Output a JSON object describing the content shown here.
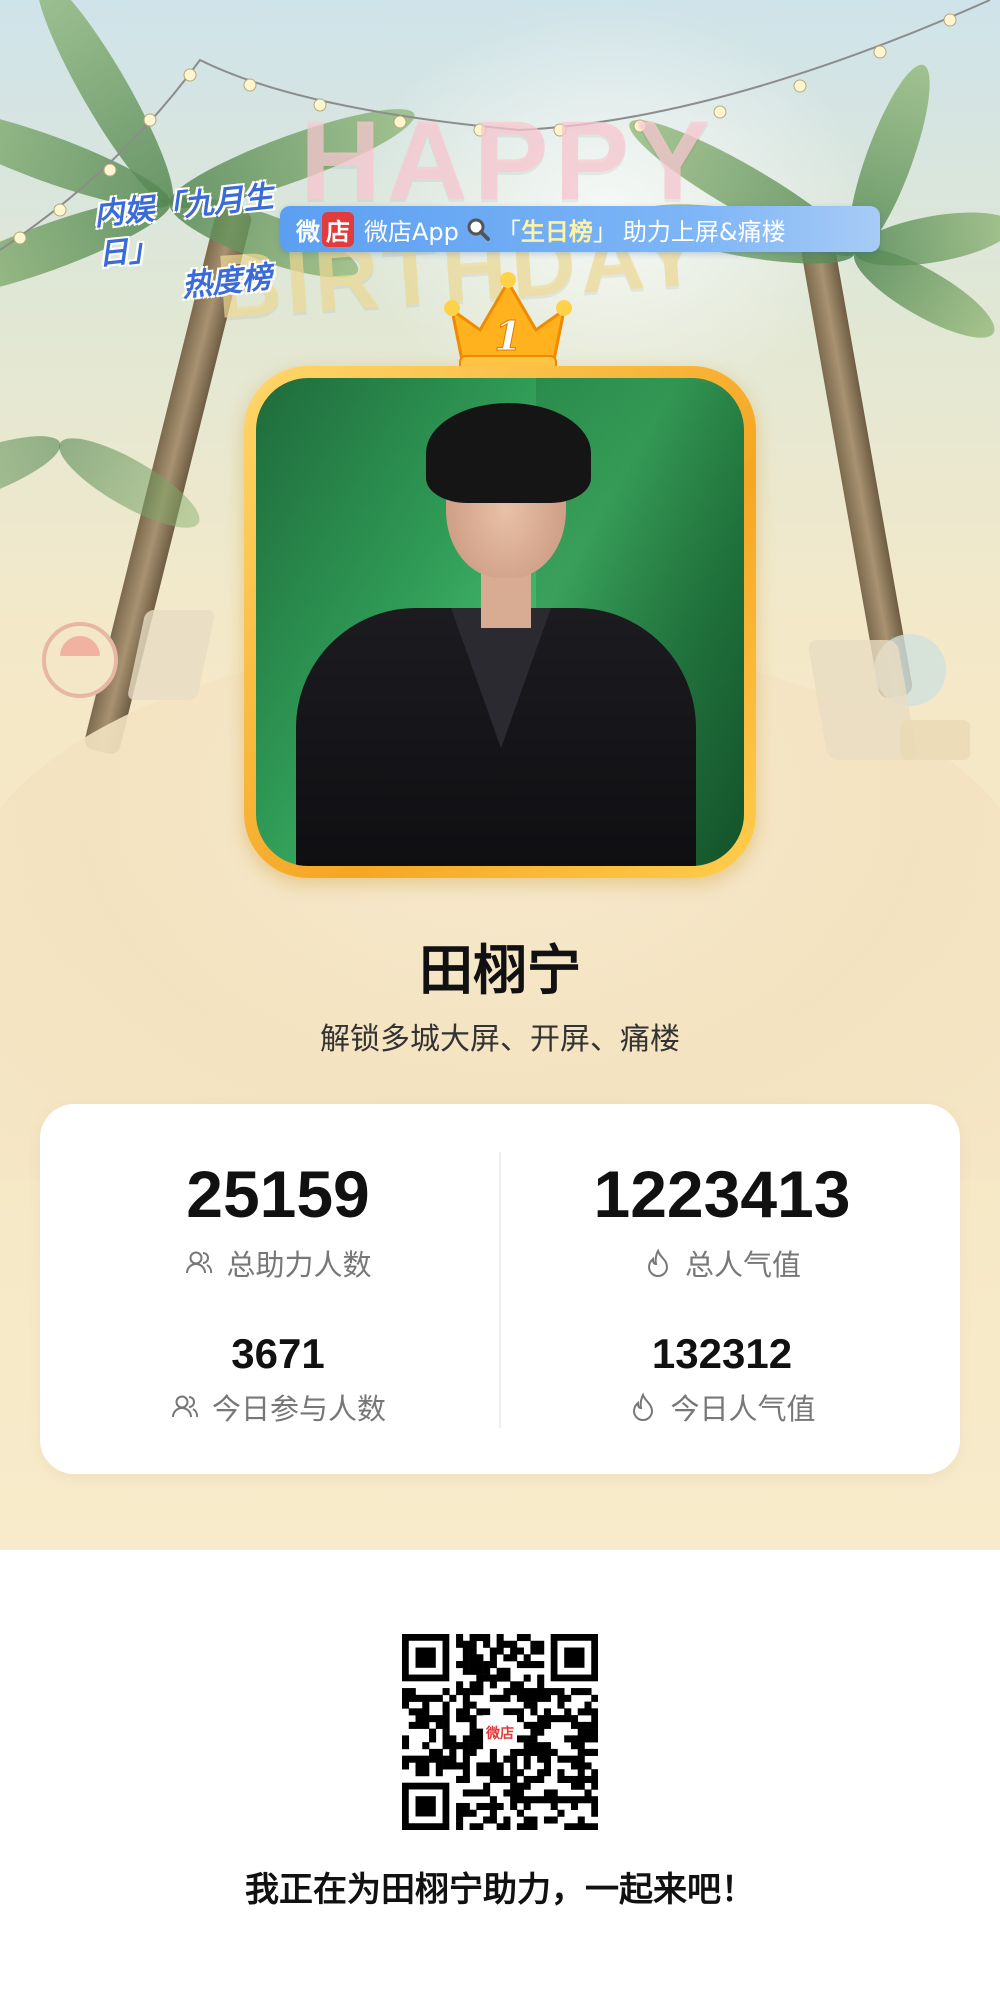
{
  "banner": {
    "logo_line1": "内娱「九月生日」",
    "logo_line2": "热度榜",
    "wd_text": "微",
    "wd_box": "店",
    "app_text": "微店App",
    "search_prefix": "「",
    "search_keyword": "生日榜",
    "search_suffix": "」",
    "tail_text": "助力上屏&痛楼"
  },
  "decor": {
    "happy": "HAPPY",
    "birthday": "BIRTHDAY",
    "rank": "1"
  },
  "profile": {
    "name": "田栩宁",
    "subtitle": "解锁多城大屏、开屏、痛楼"
  },
  "stats": {
    "total_supporters": {
      "value": "25159",
      "label": "总助力人数",
      "icon": "users-icon"
    },
    "total_popularity": {
      "value": "1223413",
      "label": "总人气值",
      "icon": "flame-icon"
    },
    "today_participants": {
      "value": "3671",
      "label": "今日参与人数",
      "icon": "users-icon"
    },
    "today_popularity": {
      "value": "132312",
      "label": "今日人气值",
      "icon": "flame-icon"
    }
  },
  "footer": {
    "qr_logo": "微店",
    "cta": "我正在为田栩宁助力，一起来吧！"
  },
  "colors": {
    "banner_blue": "#5c9ff2",
    "keyword_yellow": "#fff2a6",
    "frame_gold": "#f5a623",
    "weidian_red": "#e23b3b"
  }
}
